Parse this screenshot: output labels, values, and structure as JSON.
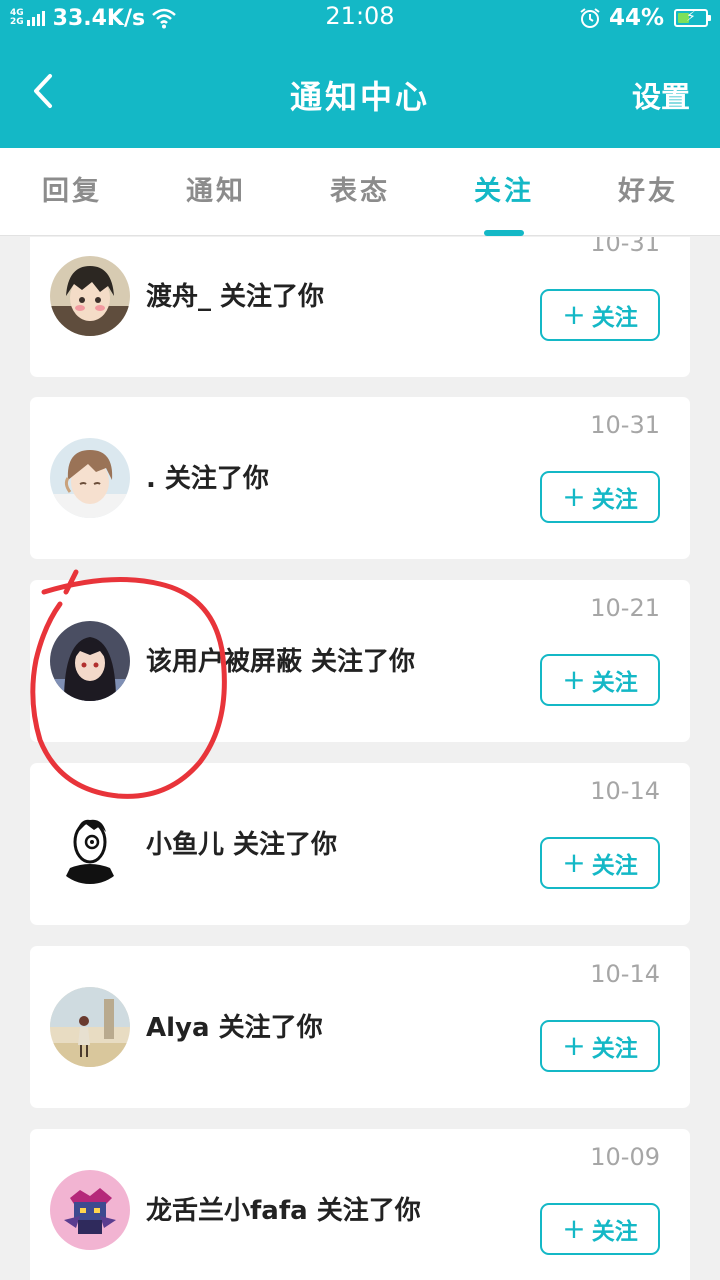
{
  "status_bar": {
    "network_top": "4G",
    "network_bottom": "2G",
    "speed": "33.4K/s",
    "time": "21:08",
    "battery": "44%",
    "battery_level": 0.44,
    "icons": [
      "signal-icon",
      "wifi-icon",
      "alarm-icon",
      "battery-charging-icon"
    ]
  },
  "header": {
    "title": "通知中心",
    "settings_label": "设置",
    "back_icon": "chevron-left-icon"
  },
  "tabs": [
    {
      "label": "回复",
      "active": false
    },
    {
      "label": "通知",
      "active": false
    },
    {
      "label": "表态",
      "active": false
    },
    {
      "label": "关注",
      "active": true
    },
    {
      "label": "好友",
      "active": false
    }
  ],
  "follow_button_label": "关注",
  "notifications": [
    {
      "text": "渡舟_ 关注了你",
      "date": "10-31"
    },
    {
      "text": ". 关注了你",
      "date": "10-31"
    },
    {
      "text": "该用户被屏蔽 关注了你",
      "date": "10-21"
    },
    {
      "text": "小鱼儿 关注了你",
      "date": "10-14"
    },
    {
      "text": "Alya 关注了你",
      "date": "10-14"
    },
    {
      "text": "龙舌兰小fafa 关注了你",
      "date": "10-09"
    }
  ],
  "colors": {
    "accent": "#14b8c6",
    "annotation": "#e8343a"
  }
}
